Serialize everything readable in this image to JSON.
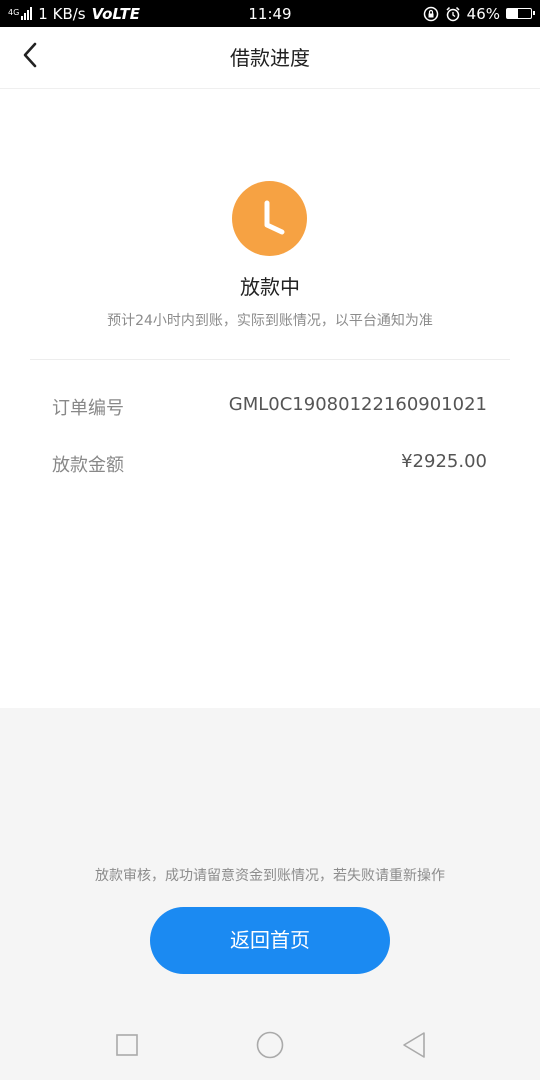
{
  "status_bar": {
    "network_type": "4G",
    "speed": "1 KB/s",
    "volte": "VoLTE",
    "time": "11:49",
    "battery_percent": "46%",
    "battery_level": 0.46,
    "icons": [
      "signal-icon",
      "lock-rotation-icon",
      "alarm-icon",
      "battery-icon"
    ]
  },
  "header": {
    "title": "借款进度",
    "back_icon": "chevron-left-icon"
  },
  "status": {
    "icon": "clock-icon",
    "icon_color": "#f6a243",
    "title": "放款中",
    "description": "预计24小时内到账，实际到账情况，以平台通知为准"
  },
  "details": [
    {
      "label": "订单编号",
      "value": "GML0C19080122160901021"
    },
    {
      "label": "放款金额",
      "value": "¥2925.00"
    }
  ],
  "footer": {
    "note": "放款审核，成功请留意资金到账情况，若失败请重新操作",
    "button_label": "返回首页",
    "button_color": "#1b8af2"
  },
  "nav_bar": {
    "icons": [
      "recent-apps-icon",
      "home-icon",
      "back-icon"
    ]
  }
}
